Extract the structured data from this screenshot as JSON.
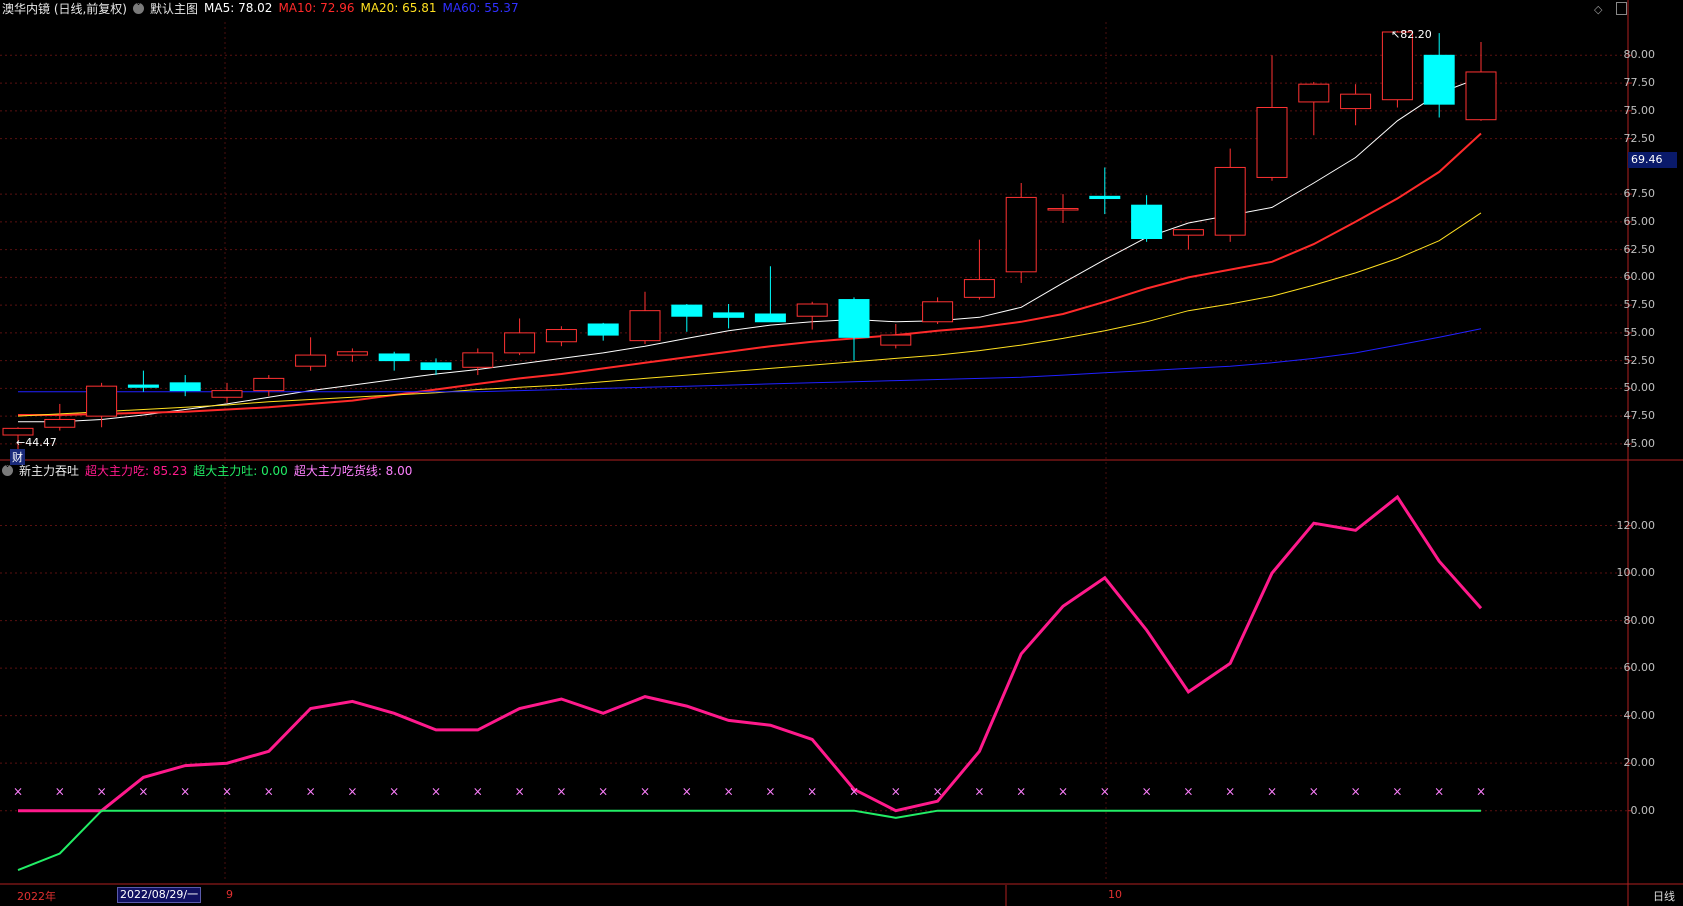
{
  "header": {
    "stock": "澳华内镜 (日线,前复权)",
    "menu_icon": "circle-chevron-icon",
    "main_chart": "默认主图",
    "ma5": "MA5: 78.02",
    "ma10": "MA10: 72.96",
    "ma20": "MA20: 65.81",
    "ma60": "MA60: 55.37",
    "colors": {
      "ma5": "#ffffff",
      "ma10": "#ff2a2a",
      "ma20": "#ffe020",
      "ma60": "#2020ff"
    }
  },
  "price_axis": {
    "ticks": [
      "80.00",
      "77.50",
      "75.00",
      "72.50",
      "67.50",
      "65.00",
      "62.50",
      "60.00",
      "57.50",
      "55.00",
      "52.50",
      "50.00",
      "47.50",
      "45.00"
    ],
    "current": "69.46"
  },
  "annotations": {
    "high": "82.20",
    "low": "44.47",
    "finance_mark": "财"
  },
  "indicator": {
    "name": "新主力吞吐",
    "eat_label": "超大主力吃: 85.23",
    "spit_label": "超大主力吐: 0.00",
    "line_label": "超大主力吃货线: 8.00",
    "ticks": [
      "120.00",
      "100.00",
      "80.00",
      "60.00",
      "40.00",
      "20.00",
      "0.00"
    ],
    "colors": {
      "eat": "#ff1a8c",
      "spit": "#22ee66",
      "line": "#ff80ff"
    }
  },
  "time_axis": {
    "year": "2022年",
    "cursor_date": "2022/08/29/一",
    "month_9": "9",
    "month_10": "10"
  },
  "period_button": "日线",
  "chart_data": [
    {
      "type": "candlestick",
      "title": "澳华内镜 (日线,前复权)",
      "ylim": [
        44,
        83
      ],
      "candles": [
        {
          "o": 45.8,
          "h": 46.5,
          "l": 44.47,
          "c": 46.4
        },
        {
          "o": 46.5,
          "h": 48.6,
          "l": 46.2,
          "c": 47.2
        },
        {
          "o": 47.5,
          "h": 50.5,
          "l": 46.5,
          "c": 50.2
        },
        {
          "o": 50.3,
          "h": 51.6,
          "l": 49.7,
          "c": 50.1
        },
        {
          "o": 50.5,
          "h": 51.2,
          "l": 49.3,
          "c": 49.8
        },
        {
          "o": 49.2,
          "h": 50.5,
          "l": 48.7,
          "c": 49.8
        },
        {
          "o": 49.8,
          "h": 51.2,
          "l": 49.3,
          "c": 50.9
        },
        {
          "o": 52.0,
          "h": 54.6,
          "l": 51.6,
          "c": 53.0
        },
        {
          "o": 53.0,
          "h": 53.6,
          "l": 52.4,
          "c": 53.3
        },
        {
          "o": 53.1,
          "h": 53.3,
          "l": 51.6,
          "c": 52.5
        },
        {
          "o": 52.3,
          "h": 52.7,
          "l": 51.2,
          "c": 51.7
        },
        {
          "o": 51.9,
          "h": 53.6,
          "l": 51.2,
          "c": 53.2
        },
        {
          "o": 53.2,
          "h": 56.3,
          "l": 53.0,
          "c": 55.0
        },
        {
          "o": 54.2,
          "h": 55.6,
          "l": 53.8,
          "c": 55.3
        },
        {
          "o": 55.8,
          "h": 55.9,
          "l": 54.3,
          "c": 54.8
        },
        {
          "o": 54.3,
          "h": 58.7,
          "l": 54.0,
          "c": 57.0
        },
        {
          "o": 57.5,
          "h": 57.6,
          "l": 55.1,
          "c": 56.5
        },
        {
          "o": 56.8,
          "h": 57.6,
          "l": 55.4,
          "c": 56.4
        },
        {
          "o": 56.7,
          "h": 61.0,
          "l": 56.2,
          "c": 56.0
        },
        {
          "o": 56.5,
          "h": 57.8,
          "l": 55.3,
          "c": 57.6
        },
        {
          "o": 58.0,
          "h": 58.2,
          "l": 52.5,
          "c": 54.6
        },
        {
          "o": 53.9,
          "h": 55.8,
          "l": 53.6,
          "c": 54.8
        },
        {
          "o": 56.0,
          "h": 58.2,
          "l": 55.8,
          "c": 57.8
        },
        {
          "o": 58.2,
          "h": 63.4,
          "l": 58.0,
          "c": 59.8
        },
        {
          "o": 60.5,
          "h": 68.5,
          "l": 59.5,
          "c": 67.2
        },
        {
          "o": 66.2,
          "h": 67.5,
          "l": 64.9,
          "c": 66.2
        },
        {
          "o": 67.3,
          "h": 69.9,
          "l": 65.7,
          "c": 67.1
        },
        {
          "o": 66.5,
          "h": 67.4,
          "l": 63.2,
          "c": 63.5
        },
        {
          "o": 63.8,
          "h": 64.3,
          "l": 62.5,
          "c": 64.3
        },
        {
          "o": 63.8,
          "h": 71.6,
          "l": 63.2,
          "c": 69.9
        },
        {
          "o": 69.0,
          "h": 80.0,
          "l": 68.7,
          "c": 75.3
        },
        {
          "o": 75.8,
          "h": 77.6,
          "l": 72.8,
          "c": 77.4
        },
        {
          "o": 75.2,
          "h": 77.4,
          "l": 73.7,
          "c": 76.5
        },
        {
          "o": 76.0,
          "h": 82.2,
          "l": 75.3,
          "c": 82.1
        },
        {
          "o": 80.0,
          "h": 82.0,
          "l": 74.4,
          "c": 75.6
        },
        {
          "o": 74.2,
          "h": 81.2,
          "l": 74.1,
          "c": 78.5
        }
      ],
      "series": [
        {
          "name": "MA5",
          "values": [
            47.0,
            47.0,
            47.2,
            47.6,
            48.1,
            48.6,
            49.2,
            49.8,
            50.3,
            50.8,
            51.3,
            51.7,
            52.2,
            52.7,
            53.2,
            53.8,
            54.5,
            55.2,
            55.7,
            56.0,
            56.2,
            56.0,
            56.1,
            56.4,
            57.3,
            59.5,
            61.6,
            63.6,
            64.9,
            65.6,
            66.3,
            68.5,
            70.8,
            74.1,
            76.6,
            78.02
          ]
        },
        {
          "name": "MA10",
          "values": [
            47.6,
            47.6,
            47.7,
            47.8,
            47.9,
            48.1,
            48.3,
            48.6,
            48.9,
            49.4,
            49.9,
            50.4,
            50.9,
            51.3,
            51.8,
            52.3,
            52.8,
            53.3,
            53.8,
            54.2,
            54.5,
            54.8,
            55.2,
            55.5,
            56.0,
            56.7,
            57.8,
            59.0,
            60.0,
            60.7,
            61.4,
            63.0,
            65.0,
            67.1,
            69.5,
            72.96
          ]
        },
        {
          "name": "MA20",
          "values": [
            47.5,
            47.7,
            47.9,
            48.1,
            48.3,
            48.5,
            48.8,
            49.0,
            49.2,
            49.4,
            49.6,
            49.9,
            50.1,
            50.3,
            50.6,
            50.9,
            51.2,
            51.5,
            51.8,
            52.1,
            52.4,
            52.7,
            53.0,
            53.4,
            53.9,
            54.5,
            55.2,
            56.0,
            57.0,
            57.6,
            58.3,
            59.3,
            60.4,
            61.7,
            63.3,
            65.81
          ]
        },
        {
          "name": "MA60",
          "values": [
            49.7,
            49.7,
            49.7,
            49.7,
            49.7,
            49.7,
            49.7,
            49.7,
            49.7,
            49.7,
            49.7,
            49.7,
            49.8,
            49.9,
            50.0,
            50.1,
            50.2,
            50.3,
            50.4,
            50.5,
            50.6,
            50.7,
            50.8,
            50.9,
            51.0,
            51.2,
            51.4,
            51.6,
            51.8,
            52.0,
            52.3,
            52.7,
            53.2,
            53.9,
            54.6,
            55.37
          ]
        }
      ]
    },
    {
      "type": "line",
      "title": "新主力吞吐",
      "ylim": [
        -30,
        140
      ],
      "series": [
        {
          "name": "超大主力吃",
          "values": [
            0,
            0,
            0,
            14,
            19,
            20,
            25,
            43,
            46,
            41,
            34,
            34,
            43,
            47,
            41,
            48,
            44,
            38,
            36,
            30,
            9,
            0,
            4,
            25,
            66,
            86,
            98,
            76,
            50,
            62,
            100,
            121,
            118,
            132,
            105,
            85.23
          ]
        },
        {
          "name": "超大主力吐",
          "values": [
            -25,
            -18,
            0,
            0,
            0,
            0,
            0,
            0,
            0,
            0,
            0,
            0,
            0,
            0,
            0,
            0,
            0,
            0,
            0,
            0,
            0,
            -3,
            0,
            0,
            0,
            0,
            0,
            0,
            0,
            0,
            0,
            0,
            0,
            0,
            0,
            0.0
          ]
        },
        {
          "name": "超大主力吃货线",
          "values": [
            8,
            8,
            8,
            8,
            8,
            8,
            8,
            8,
            8,
            8,
            8,
            8,
            8,
            8,
            8,
            8,
            8,
            8,
            8,
            8,
            8,
            8,
            8,
            8,
            8,
            8,
            8,
            8,
            8,
            8,
            8,
            8,
            8,
            8,
            8,
            8.0
          ]
        }
      ]
    }
  ]
}
